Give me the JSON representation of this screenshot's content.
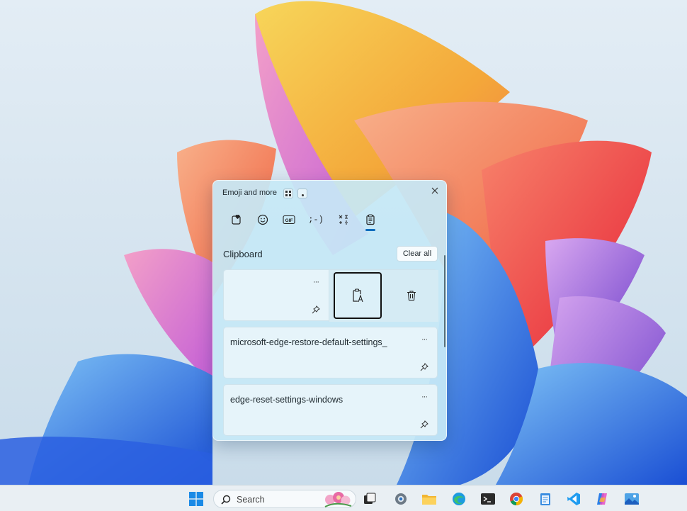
{
  "panel": {
    "title": "Emoji and more",
    "section_title": "Clipboard",
    "clear_all_label": "Clear all",
    "tabs": [
      {
        "name": "favorites-icon"
      },
      {
        "name": "emoji-icon"
      },
      {
        "name": "gif-icon",
        "label": "GIF"
      },
      {
        "name": "kaomoji-icon",
        "label": ";-)"
      },
      {
        "name": "symbols-icon"
      },
      {
        "name": "clipboard-icon"
      }
    ],
    "active_tab": "clipboard",
    "items": [
      {
        "text": ""
      },
      {
        "text": "microsoft-edge-restore-default-settings_"
      },
      {
        "text": "edge-reset-settings-windows"
      }
    ],
    "more_label": "···"
  },
  "taskbar": {
    "search_placeholder": "Search",
    "apps": [
      "start-icon",
      "task-view-icon",
      "settings-icon",
      "file-explorer-icon",
      "edge-icon",
      "terminal-icon",
      "chrome-icon",
      "notepad-icon",
      "vscode-icon",
      "copilot-icon",
      "photos-icon"
    ]
  },
  "colors": {
    "accent": "#0f6cbd",
    "panel_bg": "#c6e8f6"
  }
}
